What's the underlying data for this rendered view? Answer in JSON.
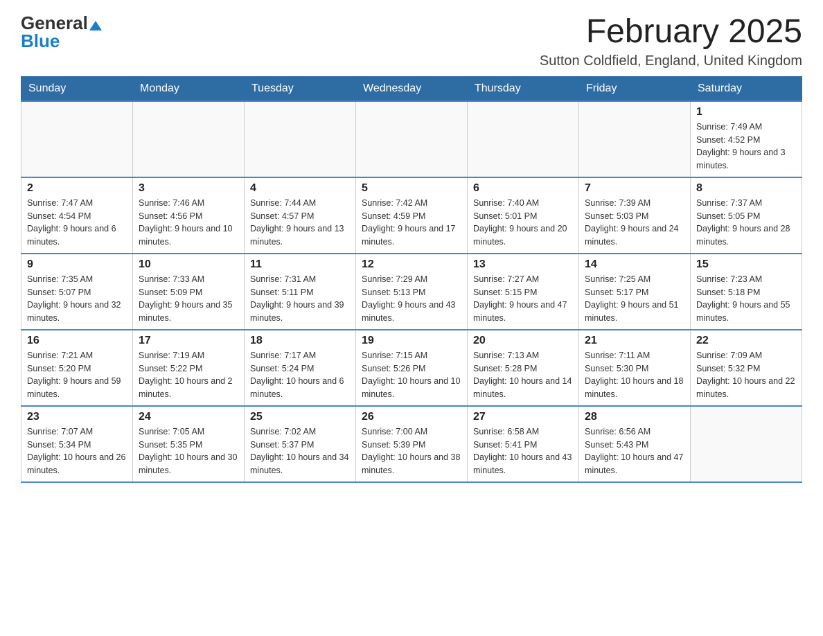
{
  "header": {
    "logo_general": "General",
    "logo_blue": "Blue",
    "month_year": "February 2025",
    "location": "Sutton Coldfield, England, United Kingdom"
  },
  "calendar": {
    "days_of_week": [
      "Sunday",
      "Monday",
      "Tuesday",
      "Wednesday",
      "Thursday",
      "Friday",
      "Saturday"
    ],
    "weeks": [
      [
        {
          "day": "",
          "info": ""
        },
        {
          "day": "",
          "info": ""
        },
        {
          "day": "",
          "info": ""
        },
        {
          "day": "",
          "info": ""
        },
        {
          "day": "",
          "info": ""
        },
        {
          "day": "",
          "info": ""
        },
        {
          "day": "1",
          "info": "Sunrise: 7:49 AM\nSunset: 4:52 PM\nDaylight: 9 hours and 3 minutes."
        }
      ],
      [
        {
          "day": "2",
          "info": "Sunrise: 7:47 AM\nSunset: 4:54 PM\nDaylight: 9 hours and 6 minutes."
        },
        {
          "day": "3",
          "info": "Sunrise: 7:46 AM\nSunset: 4:56 PM\nDaylight: 9 hours and 10 minutes."
        },
        {
          "day": "4",
          "info": "Sunrise: 7:44 AM\nSunset: 4:57 PM\nDaylight: 9 hours and 13 minutes."
        },
        {
          "day": "5",
          "info": "Sunrise: 7:42 AM\nSunset: 4:59 PM\nDaylight: 9 hours and 17 minutes."
        },
        {
          "day": "6",
          "info": "Sunrise: 7:40 AM\nSunset: 5:01 PM\nDaylight: 9 hours and 20 minutes."
        },
        {
          "day": "7",
          "info": "Sunrise: 7:39 AM\nSunset: 5:03 PM\nDaylight: 9 hours and 24 minutes."
        },
        {
          "day": "8",
          "info": "Sunrise: 7:37 AM\nSunset: 5:05 PM\nDaylight: 9 hours and 28 minutes."
        }
      ],
      [
        {
          "day": "9",
          "info": "Sunrise: 7:35 AM\nSunset: 5:07 PM\nDaylight: 9 hours and 32 minutes."
        },
        {
          "day": "10",
          "info": "Sunrise: 7:33 AM\nSunset: 5:09 PM\nDaylight: 9 hours and 35 minutes."
        },
        {
          "day": "11",
          "info": "Sunrise: 7:31 AM\nSunset: 5:11 PM\nDaylight: 9 hours and 39 minutes."
        },
        {
          "day": "12",
          "info": "Sunrise: 7:29 AM\nSunset: 5:13 PM\nDaylight: 9 hours and 43 minutes."
        },
        {
          "day": "13",
          "info": "Sunrise: 7:27 AM\nSunset: 5:15 PM\nDaylight: 9 hours and 47 minutes."
        },
        {
          "day": "14",
          "info": "Sunrise: 7:25 AM\nSunset: 5:17 PM\nDaylight: 9 hours and 51 minutes."
        },
        {
          "day": "15",
          "info": "Sunrise: 7:23 AM\nSunset: 5:18 PM\nDaylight: 9 hours and 55 minutes."
        }
      ],
      [
        {
          "day": "16",
          "info": "Sunrise: 7:21 AM\nSunset: 5:20 PM\nDaylight: 9 hours and 59 minutes."
        },
        {
          "day": "17",
          "info": "Sunrise: 7:19 AM\nSunset: 5:22 PM\nDaylight: 10 hours and 2 minutes."
        },
        {
          "day": "18",
          "info": "Sunrise: 7:17 AM\nSunset: 5:24 PM\nDaylight: 10 hours and 6 minutes."
        },
        {
          "day": "19",
          "info": "Sunrise: 7:15 AM\nSunset: 5:26 PM\nDaylight: 10 hours and 10 minutes."
        },
        {
          "day": "20",
          "info": "Sunrise: 7:13 AM\nSunset: 5:28 PM\nDaylight: 10 hours and 14 minutes."
        },
        {
          "day": "21",
          "info": "Sunrise: 7:11 AM\nSunset: 5:30 PM\nDaylight: 10 hours and 18 minutes."
        },
        {
          "day": "22",
          "info": "Sunrise: 7:09 AM\nSunset: 5:32 PM\nDaylight: 10 hours and 22 minutes."
        }
      ],
      [
        {
          "day": "23",
          "info": "Sunrise: 7:07 AM\nSunset: 5:34 PM\nDaylight: 10 hours and 26 minutes."
        },
        {
          "day": "24",
          "info": "Sunrise: 7:05 AM\nSunset: 5:35 PM\nDaylight: 10 hours and 30 minutes."
        },
        {
          "day": "25",
          "info": "Sunrise: 7:02 AM\nSunset: 5:37 PM\nDaylight: 10 hours and 34 minutes."
        },
        {
          "day": "26",
          "info": "Sunrise: 7:00 AM\nSunset: 5:39 PM\nDaylight: 10 hours and 38 minutes."
        },
        {
          "day": "27",
          "info": "Sunrise: 6:58 AM\nSunset: 5:41 PM\nDaylight: 10 hours and 43 minutes."
        },
        {
          "day": "28",
          "info": "Sunrise: 6:56 AM\nSunset: 5:43 PM\nDaylight: 10 hours and 47 minutes."
        },
        {
          "day": "",
          "info": ""
        }
      ]
    ]
  }
}
